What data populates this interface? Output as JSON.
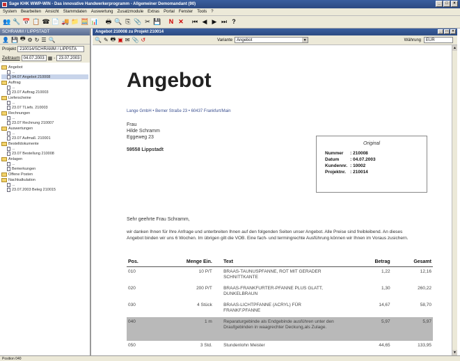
{
  "app": {
    "title": "Sage KHK WWP-WIN - Das innovative Handwerkerprogramm - Allgemeiner Demomandant (90)"
  },
  "menu": [
    "System",
    "Bearbeiten",
    "Ansicht",
    "Stammdaten",
    "Auswertung",
    "Zusatzmodule",
    "Extras",
    "Portal",
    "Fenster",
    "Tools",
    "?"
  ],
  "left_panel": {
    "title": "SCHRAMM / LIPPSTADT",
    "projekt_label": "Projekt",
    "projekt_value": "210014/SCHRAMM / LIPPSTA",
    "zeitraum_label": "Zeitraum",
    "date_from": "04.07.2003",
    "date_to": "23.07.2003",
    "tree": [
      {
        "folder": "Angebot",
        "items": [
          "...",
          "04.07 Angebot 210008"
        ],
        "selected": 1
      },
      {
        "folder": "Auftrag",
        "items": [
          "...",
          "23.07 Auftrag 210003"
        ]
      },
      {
        "folder": "Lieferscheine",
        "items": [
          "...",
          "23.07 TLiefs. 210003"
        ]
      },
      {
        "folder": "Rechnungen",
        "items": [
          "...",
          "23.07 Rechnung 210007"
        ]
      },
      {
        "folder": "Auswertungen",
        "items": [
          "...",
          "23.07 Aufmaß. 210001"
        ]
      },
      {
        "folder": "Bestelldokumente",
        "items": [
          "...",
          "23.07 Bestellung 210008"
        ]
      },
      {
        "folder": "Anlagen",
        "items": [
          "...",
          "Bemerkungen"
        ]
      },
      {
        "folder": "Offene Posten",
        "items": []
      },
      {
        "folder": "Nachkalkulation",
        "items": [
          "...",
          "23.07.2003 Beleg 210015"
        ]
      }
    ]
  },
  "doc_window": {
    "title": "Angebot 210008 zu Projekt 210014",
    "variante_label": "Variante",
    "variante_value": "Angebot",
    "waehrung_label": "Währung",
    "waehrung_value": "EUR"
  },
  "document": {
    "heading": "Angebot",
    "sender_line": "Lange GmbH • Berner Straße 23 • 60437 Frankfurt/Main",
    "recipient": {
      "salutation": "Frau",
      "name": "Hilde Schramm",
      "street": "Eggeweg 23",
      "city": "59558 Lippstadt"
    },
    "infobox": {
      "caption": "Original",
      "rows": [
        {
          "label": "Nummer",
          "value": ": 210008"
        },
        {
          "label": "Datum",
          "value": ": 04.07.2003"
        },
        {
          "label": "Kundennr.",
          "value": ": 10002"
        },
        {
          "label": "Projektnr.",
          "value": ": 210014"
        }
      ]
    },
    "greeting": "Sehr geehrte Frau Schramm,",
    "intro": "wir danken Ihnen für Ihre Anfrage und unterbreiten Ihnen auf den folgenden Seiten unser Angebot. Alle Preise sind freibleibend. An dieses Angebot binden wir uns 6 Wochen. Im übrigen gilt die VOB. Eine fach- und termingrechte Ausführung können wir Ihnen im Voraus zusichern.",
    "columns": {
      "pos": "Pos.",
      "menge": "Menge Ein.",
      "text": "Text",
      "betrag": "Betrag",
      "gesamt": "Gesamt"
    },
    "items": [
      {
        "pos": "010",
        "menge": "10 P/T",
        "text": "BRAAS-TAUNUSPFANNE, ROT MIT GERADER SCHNITTKANTE",
        "betrag": "1,22",
        "gesamt": "12,16"
      },
      {
        "pos": "020",
        "menge": "200 P/T",
        "text": "BRAAS-FRANKFURTER-PFANNE PLUS GLATT, DUNKELBRAUN",
        "betrag": "1,30",
        "gesamt": "260,22"
      },
      {
        "pos": "030",
        "menge": "4 Stück",
        "text": "BRAAS-LICHTPFANNE (ACRYL) FÜR FRANKF.PFANNE",
        "betrag": "14,67",
        "gesamt": "58,70"
      },
      {
        "pos": "040",
        "menge": "1 m",
        "text": "Reparaturgebinde als Endgebinde ausführen unter den Draufgebinden in waagrechter Deckung,als Zulage.",
        "betrag": "5,97",
        "gesamt": "5,97",
        "highlighted": true
      },
      {
        "pos": "050",
        "menge": "3 Std.",
        "text": "Stundenlohn Meister",
        "betrag": "44,65",
        "gesamt": "133,95"
      }
    ]
  },
  "status": {
    "text": "Position 040"
  }
}
